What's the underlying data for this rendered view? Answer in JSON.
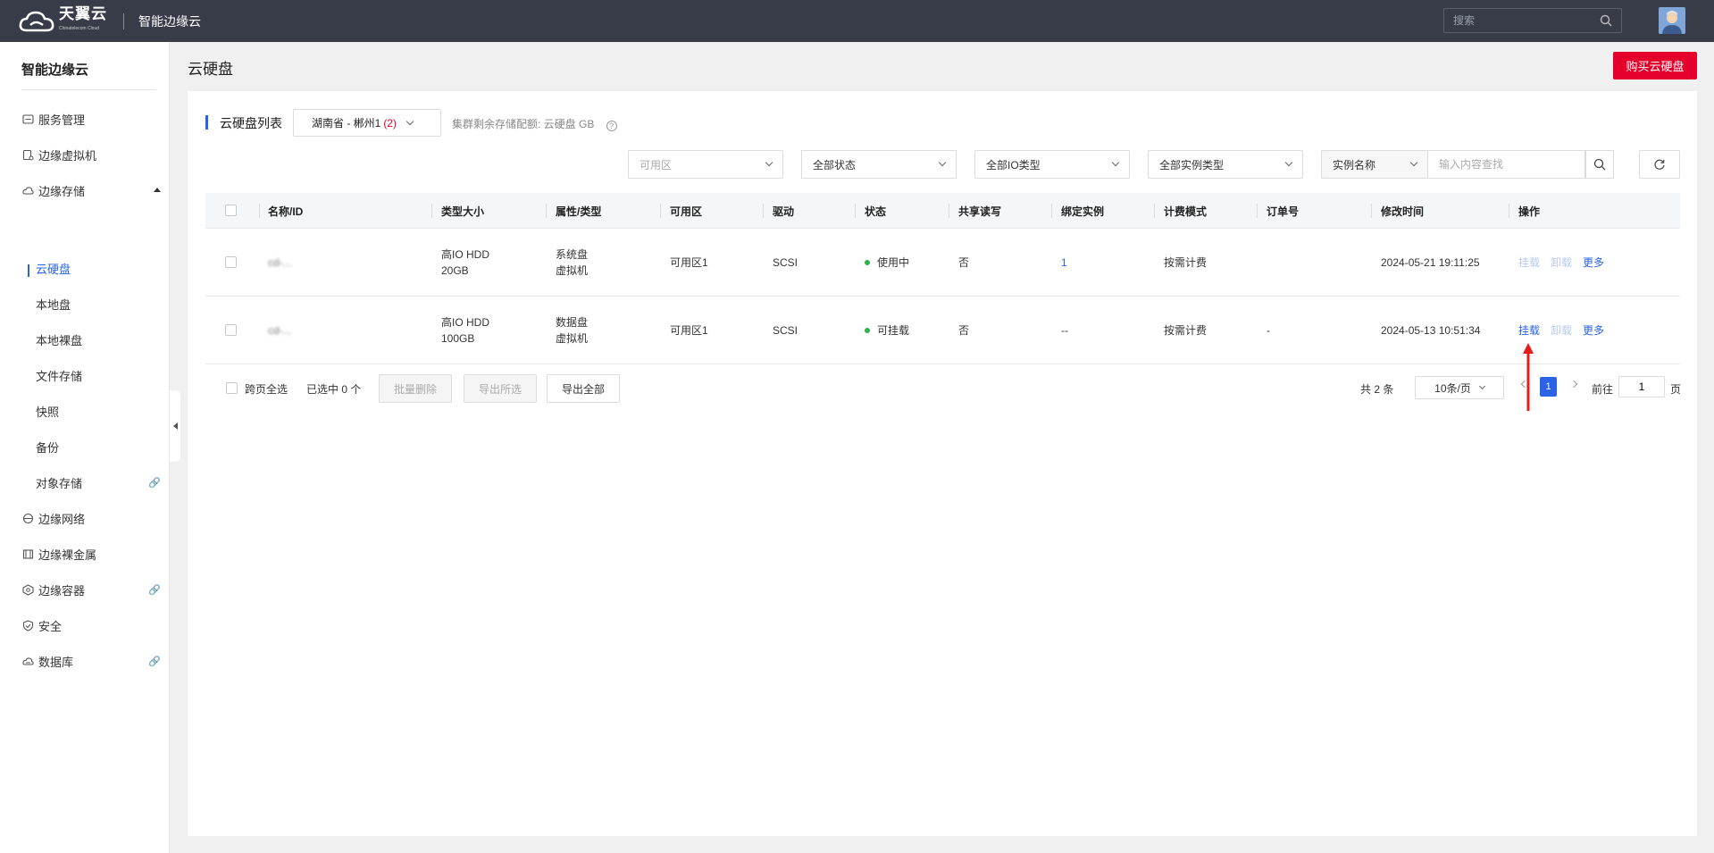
{
  "header": {
    "logo_text": "天翼云",
    "logo_sub": "Chinatelecom Cloud",
    "product_name": "智能边缘云",
    "search_placeholder": "搜索"
  },
  "sidebar": {
    "title": "智能边缘云",
    "items": [
      {
        "label": "服务管理"
      },
      {
        "label": "边缘虚拟机"
      },
      {
        "label": "边缘存储"
      },
      {
        "label": "云硬盘"
      },
      {
        "label": "本地盘"
      },
      {
        "label": "本地裸盘"
      },
      {
        "label": "文件存储"
      },
      {
        "label": "快照"
      },
      {
        "label": "备份"
      },
      {
        "label": "对象存储"
      },
      {
        "label": "边缘网络"
      },
      {
        "label": "边缘裸金属"
      },
      {
        "label": "边缘容器"
      },
      {
        "label": "安全"
      },
      {
        "label": "数据库"
      }
    ]
  },
  "page": {
    "title": "云硬盘",
    "buy_button": "购买云硬盘"
  },
  "list": {
    "title": "云硬盘列表",
    "region": "湖南省 - 郴州1",
    "region_count": "(2)",
    "quota_text": "集群剩余存储配额: 云硬盘 GB"
  },
  "filters": {
    "zone_placeholder": "可用区",
    "status": "全部状态",
    "io_type": "全部IO类型",
    "instance_type": "全部实例类型",
    "search_field": "实例名称",
    "search_placeholder": "输入内容查找"
  },
  "table": {
    "columns": [
      "名称/ID",
      "类型大小",
      "属性/类型",
      "可用区",
      "驱动",
      "状态",
      "共享读写",
      "绑定实例",
      "计费模式",
      "订单号",
      "修改时间",
      "操作"
    ],
    "rows": [
      {
        "name": "cd-...",
        "type": "高IO HDD",
        "size": "20GB",
        "attr": "系统盘",
        "attr_type": "虚拟机",
        "zone": "可用区1",
        "driver": "SCSI",
        "status": "使用中",
        "shared": "否",
        "instance": "1",
        "billing": "按需计费",
        "order": "",
        "modified": "2024-05-21 19:11:25",
        "actions": [
          "挂载",
          "卸载",
          "更多"
        ]
      },
      {
        "name": "cd-...",
        "type": "高IO HDD",
        "size": "100GB",
        "attr": "数据盘",
        "attr_type": "虚拟机",
        "zone": "可用区1",
        "driver": "SCSI",
        "status": "可挂载",
        "shared": "否",
        "instance": "--",
        "billing": "按需计费",
        "order": "-",
        "modified": "2024-05-13 10:51:34",
        "actions": [
          "挂载",
          "卸载",
          "更多"
        ]
      }
    ]
  },
  "footer": {
    "select_all": "跨页全选",
    "selected": "已选中 0 个",
    "batch_delete": "批量删除",
    "export_selected": "导出所选",
    "export_all": "导出全部",
    "total": "共 2 条",
    "page_size": "10条/页",
    "current_page": "1",
    "goto_label": "前往",
    "goto_value": "1",
    "page_unit": "页"
  },
  "colors": {
    "topbar": "#373c48",
    "primary": "#2a63e8",
    "buy": "#e4002b",
    "status_green": "#2bb24c"
  }
}
